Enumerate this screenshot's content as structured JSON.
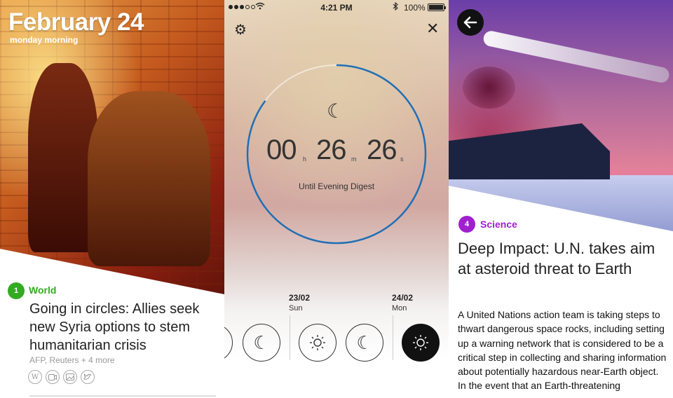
{
  "panel1": {
    "date": "February 24",
    "subtitle": "monday morning",
    "story": {
      "number": "1",
      "category": "World",
      "category_color": "#33aa22",
      "headline": "Going in circles: Allies seek new Syria options to stem humanitarian crisis",
      "sources": "AFP, Reuters + 4 more",
      "source_icons": [
        "wikipedia-icon",
        "video-icon",
        "photo-icon",
        "twitter-icon"
      ]
    }
  },
  "panel2": {
    "status_bar": {
      "time": "4:21 PM",
      "battery": "100%"
    },
    "countdown": {
      "hours": "00",
      "hours_unit": "h",
      "minutes": "26",
      "minutes_unit": "m",
      "seconds": "26",
      "seconds_unit": "s",
      "label": "Until Evening Digest",
      "ring_color": "#1f6fb5"
    },
    "days": [
      {
        "date": "23/02",
        "name": "Sun"
      },
      {
        "date": "24/02",
        "name": "Mon"
      }
    ],
    "digest_buttons": [
      {
        "icon": "moon-icon",
        "active": false
      },
      {
        "icon": "moon-icon",
        "active": false
      },
      {
        "icon": "sun-icon",
        "active": false
      },
      {
        "icon": "moon-icon",
        "active": false
      },
      {
        "icon": "sun-icon",
        "active": true
      }
    ]
  },
  "panel3": {
    "story": {
      "number": "4",
      "category": "Science",
      "category_color": "#a020d0",
      "headline": "Deep Impact: U.N. takes aim at asteroid threat to Earth",
      "body": "A United Nations action team is taking steps to thwart dangerous space rocks, including setting up a warning network that is considered to be a critical step in collecting and sharing information about potentially hazardous near-Earth object. In the event that an Earth-threatening"
    }
  }
}
